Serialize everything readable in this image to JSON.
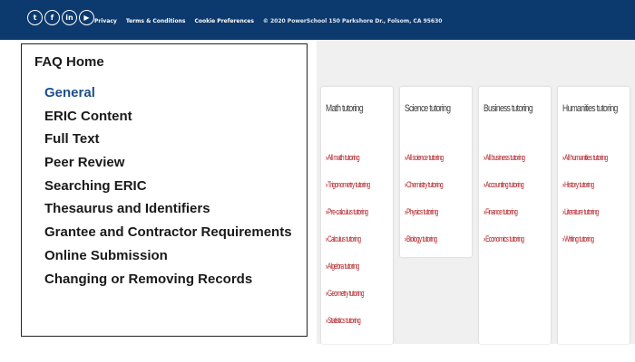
{
  "topbar": {
    "social_icons": [
      {
        "name": "twitter-icon",
        "glyph": "t"
      },
      {
        "name": "facebook-icon",
        "glyph": "f"
      },
      {
        "name": "linkedin-icon",
        "glyph": "in"
      },
      {
        "name": "youtube-icon",
        "glyph": "▶"
      }
    ],
    "links": [
      "Privacy",
      "Terms & Conditions",
      "Cookie Preferences"
    ],
    "copyright": "© 2020 PowerSchool 150 Parkshore Dr., Folsom, CA 95630"
  },
  "faq": {
    "title": "FAQ Home",
    "items": [
      {
        "label": "General",
        "active": true
      },
      {
        "label": "ERIC Content",
        "active": false
      },
      {
        "label": "Full Text",
        "active": false
      },
      {
        "label": "Peer Review",
        "active": false
      },
      {
        "label": "Searching ERIC",
        "active": false
      },
      {
        "label": "Thesaurus and Identifiers",
        "active": false
      },
      {
        "label": "Grantee and Contractor Requirements",
        "active": false
      },
      {
        "label": "Online Submission",
        "active": false
      },
      {
        "label": "Changing or Removing Records",
        "active": false
      }
    ]
  },
  "tutoring": {
    "columns": [
      {
        "title": "Math tutoring",
        "links": [
          "All math tutoring",
          "Trigonometry tutoring",
          "Pre-calculus tutoring",
          "Calculus tutoring",
          "Algebra tutoring",
          "Geometry tutoring",
          "Statistics tutoring"
        ]
      },
      {
        "title": "Science tutoring",
        "links": [
          "All science tutoring",
          "Chemistry tutoring",
          "Physics tutoring",
          "Biology tutoring"
        ]
      },
      {
        "title": "Business tutoring",
        "links": [
          "All business tutoring",
          "Accounting tutoring",
          "Finance tutoring",
          "Economics tutoring"
        ]
      },
      {
        "title": "Humanities tutoring",
        "links": [
          "All humanities tutoring",
          "History tutoring",
          "Literature tutoring",
          "Writing tutoring"
        ]
      }
    ]
  },
  "colors": {
    "topbar_bg": "#0d3a6e",
    "faq_active": "#1d4f8c",
    "tutor_link": "#b01c22"
  }
}
